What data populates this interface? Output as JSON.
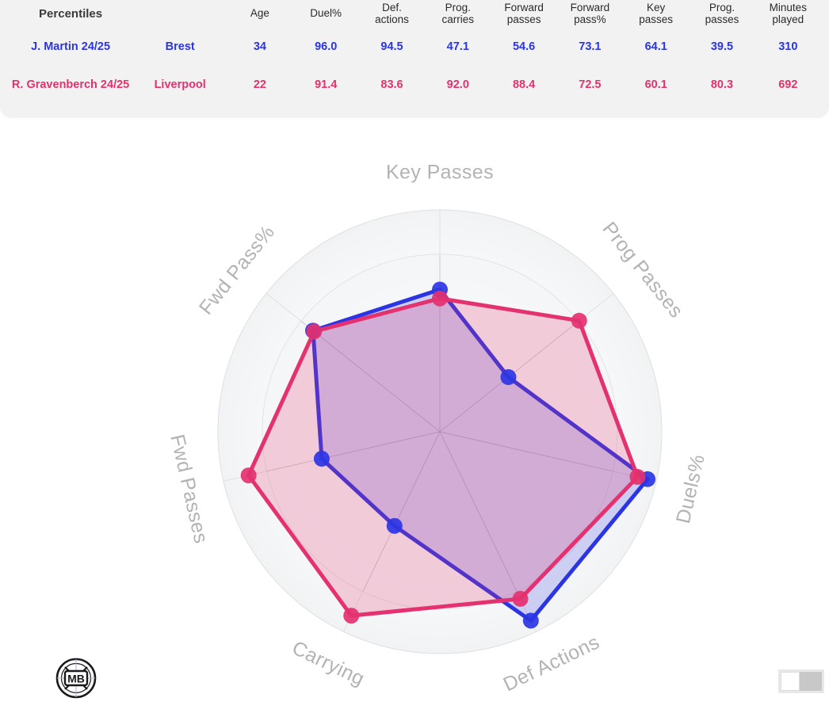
{
  "table": {
    "title": "Percentiles",
    "columns": [
      {
        "id": "player",
        "line1": "Percentiles",
        "line2": ""
      },
      {
        "id": "team",
        "line1": "",
        "line2": ""
      },
      {
        "id": "age",
        "line1": "Age",
        "line2": ""
      },
      {
        "id": "duel_pct",
        "line1": "Duel%",
        "line2": ""
      },
      {
        "id": "def_actions",
        "line1": "Def.",
        "line2": "actions"
      },
      {
        "id": "prog_carries",
        "line1": "Prog.",
        "line2": "carries"
      },
      {
        "id": "forward_passes",
        "line1": "Forward",
        "line2": "passes"
      },
      {
        "id": "forward_pass_pct",
        "line1": "Forward",
        "line2": "pass%"
      },
      {
        "id": "key_passes",
        "line1": "Key",
        "line2": "passes"
      },
      {
        "id": "prog_passes",
        "line1": "Prog.",
        "line2": "passes"
      },
      {
        "id": "minutes_played",
        "line1": "Minutes",
        "line2": "played"
      }
    ],
    "rows": [
      {
        "player": "J. Martin 24/25",
        "team": "Brest",
        "color": "#2b35e3",
        "age": "34",
        "duel_pct": "96.0",
        "def_actions": "94.5",
        "prog_carries": "47.1",
        "forward_passes": "54.6",
        "forward_pass_pct": "73.1",
        "key_passes": "64.1",
        "prog_passes": "39.5",
        "minutes_played": "310"
      },
      {
        "player": "R. Gravenberch 24/25",
        "team": "Liverpool",
        "color": "#e4316f",
        "age": "22",
        "duel_pct": "91.4",
        "def_actions": "83.6",
        "prog_carries": "92.0",
        "forward_passes": "88.4",
        "forward_pass_pct": "72.5",
        "key_passes": "60.1",
        "prog_passes": "80.3",
        "minutes_played": "692"
      }
    ]
  },
  "chart_data": {
    "type": "radar",
    "title": "",
    "axes": [
      "Key Passes",
      "Prog Passes",
      "Duels%",
      "Def Actions",
      "Carrying",
      "Fwd Passes",
      "Fwd Pass%"
    ],
    "rlim": [
      0,
      100
    ],
    "grid": true,
    "legend_position": "none",
    "series": [
      {
        "name": "J. Martin 24/25",
        "color": "#2b35e3",
        "fill": "rgba(59,70,226,0.22)",
        "values": [
          64.1,
          39.5,
          96.0,
          94.5,
          47.1,
          54.6,
          73.1
        ]
      },
      {
        "name": "R. Gravenberch 24/25",
        "color": "#e4316f",
        "fill": "rgba(228,49,111,0.22)",
        "values": [
          60.1,
          80.3,
          91.4,
          83.6,
          92.0,
          88.4,
          72.5
        ]
      }
    ]
  },
  "logo": {
    "text": "MB",
    "name": "mb-logo"
  },
  "corner": {
    "name": "resize-handle"
  }
}
